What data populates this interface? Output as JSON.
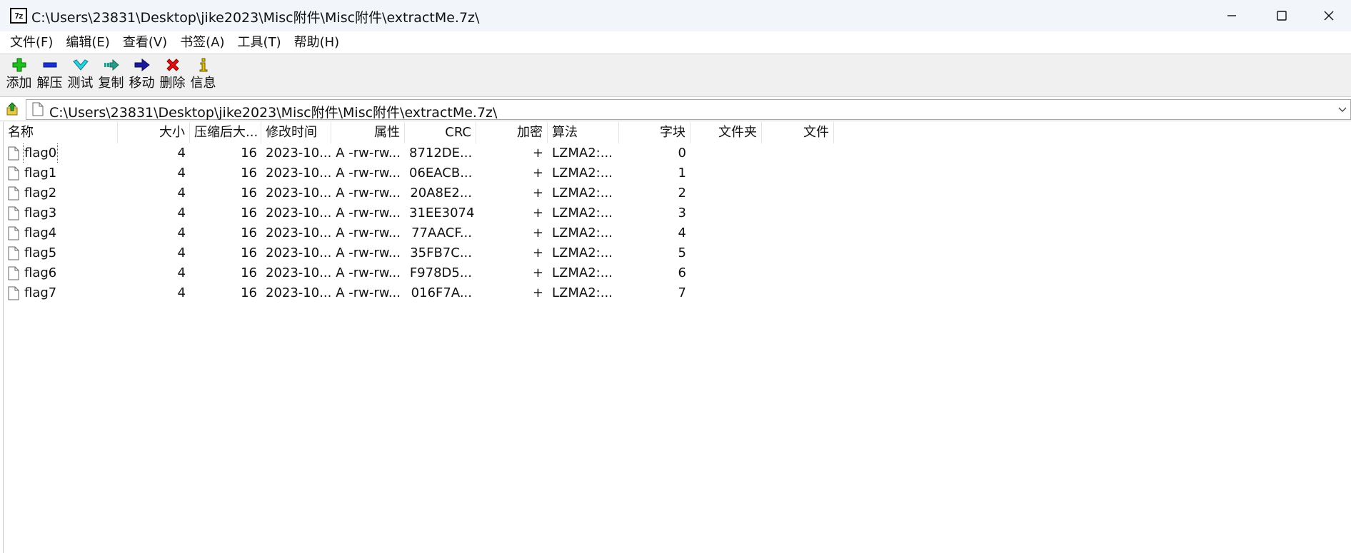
{
  "window": {
    "title": "C:\\Users\\23831\\Desktop\\jike2023\\Misc附件\\Misc附件\\extractMe.7z\\",
    "app_icon_text": "7z",
    "minimize_glyph": "—",
    "maximize_glyph": "☐",
    "close_glyph": "✕"
  },
  "menu": [
    {
      "label": "文件(F)"
    },
    {
      "label": "编辑(E)"
    },
    {
      "label": "查看(V)"
    },
    {
      "label": "书签(A)"
    },
    {
      "label": "工具(T)"
    },
    {
      "label": "帮助(H)"
    }
  ],
  "toolbar": {
    "buttons": [
      {
        "label": "添加",
        "icon": "plus-icon"
      },
      {
        "label": "解压",
        "icon": "minus-icon"
      },
      {
        "label": "测试",
        "icon": "checkmark-icon"
      },
      {
        "label": "复制",
        "icon": "copy-arrow-icon"
      },
      {
        "label": "移动",
        "icon": "move-arrow-icon"
      },
      {
        "label": "删除",
        "icon": "delete-x-icon"
      },
      {
        "label": "信息",
        "icon": "info-icon"
      }
    ]
  },
  "address": {
    "path": "C:\\Users\\23831\\Desktop\\jike2023\\Misc附件\\Misc附件\\extractMe.7z\\"
  },
  "columns": {
    "name": "名称",
    "size": "大小",
    "packed": "压缩后大...",
    "mtime": "修改时间",
    "attr": "属性",
    "crc": "CRC",
    "encrypted": "加密",
    "method": "算法",
    "block": "字块",
    "folders": "文件夹",
    "files": "文件"
  },
  "rows": [
    {
      "name": "flag0",
      "size": "4",
      "packed": "16",
      "mtime": "2023-10...",
      "attr": "A -rw-rw...",
      "crc": "8712DE...",
      "encrypted": "+",
      "method": "LZMA2:...",
      "block": "0"
    },
    {
      "name": "flag1",
      "size": "4",
      "packed": "16",
      "mtime": "2023-10...",
      "attr": "A -rw-rw...",
      "crc": "06EACB...",
      "encrypted": "+",
      "method": "LZMA2:...",
      "block": "1"
    },
    {
      "name": "flag2",
      "size": "4",
      "packed": "16",
      "mtime": "2023-10...",
      "attr": "A -rw-rw...",
      "crc": "20A8E2...",
      "encrypted": "+",
      "method": "LZMA2:...",
      "block": "2"
    },
    {
      "name": "flag3",
      "size": "4",
      "packed": "16",
      "mtime": "2023-10...",
      "attr": "A -rw-rw...",
      "crc": "31EE3074",
      "encrypted": "+",
      "method": "LZMA2:...",
      "block": "3"
    },
    {
      "name": "flag4",
      "size": "4",
      "packed": "16",
      "mtime": "2023-10...",
      "attr": "A -rw-rw...",
      "crc": "77AACF...",
      "encrypted": "+",
      "method": "LZMA2:...",
      "block": "4"
    },
    {
      "name": "flag5",
      "size": "4",
      "packed": "16",
      "mtime": "2023-10...",
      "attr": "A -rw-rw...",
      "crc": "35FB7C...",
      "encrypted": "+",
      "method": "LZMA2:...",
      "block": "5"
    },
    {
      "name": "flag6",
      "size": "4",
      "packed": "16",
      "mtime": "2023-10...",
      "attr": "A -rw-rw...",
      "crc": "F978D5...",
      "encrypted": "+",
      "method": "LZMA2:...",
      "block": "6"
    },
    {
      "name": "flag7",
      "size": "4",
      "packed": "16",
      "mtime": "2023-10...",
      "attr": "A -rw-rw...",
      "crc": "016F7A...",
      "encrypted": "+",
      "method": "LZMA2:...",
      "block": "7"
    }
  ]
}
